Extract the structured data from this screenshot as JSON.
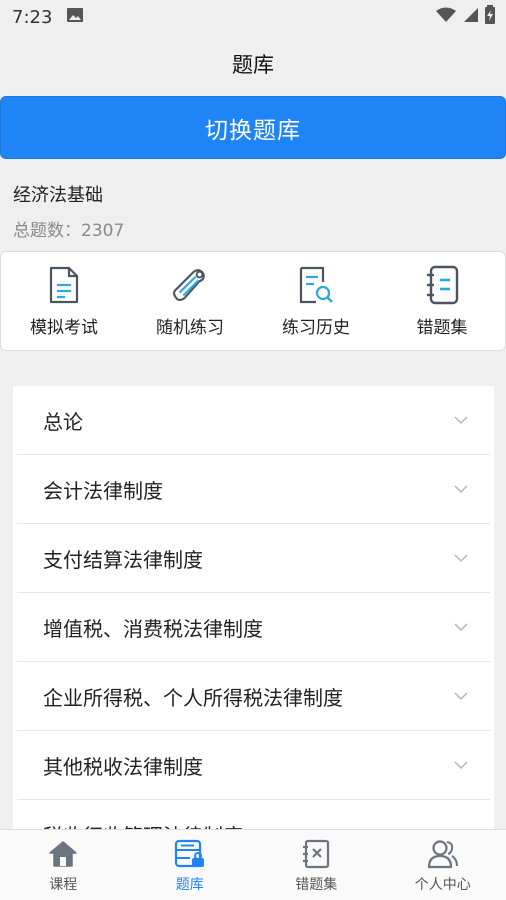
{
  "status_bar": {
    "time": "7:23"
  },
  "app_bar": {
    "title": "题库"
  },
  "switch_button": {
    "label": "切换题库"
  },
  "bank": {
    "name": "经济法基础",
    "count_text": "总题数：2307"
  },
  "quick_actions": [
    {
      "label": "模拟考试",
      "icon": "document-icon"
    },
    {
      "label": "随机练习",
      "icon": "scroll-icon"
    },
    {
      "label": "练习历史",
      "icon": "search-document-icon"
    },
    {
      "label": "错题集",
      "icon": "notebook-icon"
    }
  ],
  "chapters": [
    {
      "label": "总论"
    },
    {
      "label": "会计法律制度"
    },
    {
      "label": "支付结算法律制度"
    },
    {
      "label": "增值税、消费税法律制度"
    },
    {
      "label": "企业所得税、个人所得税法律制度"
    },
    {
      "label": "其他税收法律制度"
    },
    {
      "label": "税收征收管理法律制度"
    }
  ],
  "tabs": [
    {
      "label": "课程",
      "icon": "home-icon",
      "active": false
    },
    {
      "label": "题库",
      "icon": "question-bank-icon",
      "active": true
    },
    {
      "label": "错题集",
      "icon": "wrong-book-icon",
      "active": false
    },
    {
      "label": "个人中心",
      "icon": "profile-icon",
      "active": false
    }
  ],
  "colors": {
    "accent": "#1f84f5",
    "icon_blue": "#2aa8e0",
    "icon_dark": "#4a5560",
    "background": "#efefef"
  }
}
